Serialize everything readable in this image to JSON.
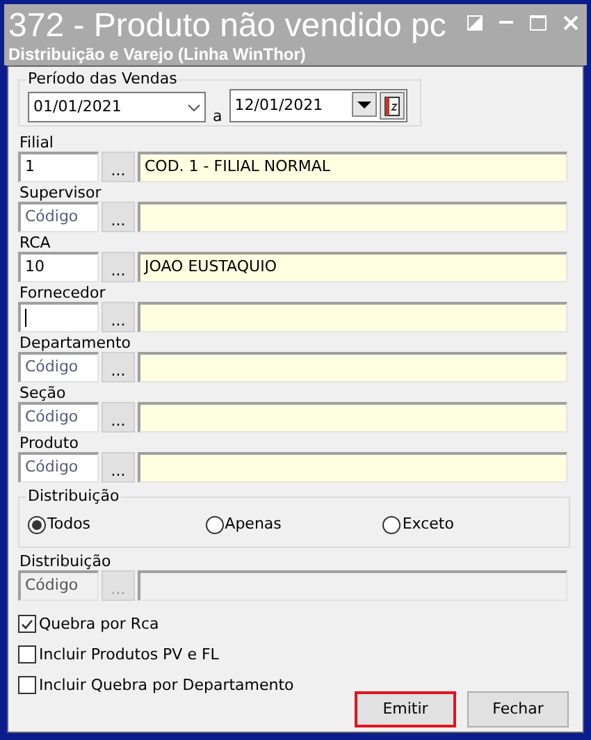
{
  "window": {
    "title": "372 - Produto não vendido pc",
    "subtitle": "Distribuição e Varejo (Linha WinThor)"
  },
  "period": {
    "label": "Período das Vendas",
    "start": "01/01/2021",
    "separator": "a",
    "end": "12/01/2021"
  },
  "fields": [
    {
      "label": "Filial",
      "code": "1",
      "description": "COD. 1 - FILIAL NORMAL",
      "focused": false,
      "disabled": false,
      "button": "..."
    },
    {
      "label": "Supervisor",
      "placeholder": "Código",
      "focused": false,
      "disabled": false,
      "button": "..."
    },
    {
      "label": "RCA",
      "code": "10",
      "description": "JOAO EUSTAQUIO",
      "focused": false,
      "disabled": false,
      "button": "..."
    },
    {
      "label": "Fornecedor",
      "focused": true,
      "disabled": false,
      "button": "..."
    },
    {
      "label": "Departamento",
      "placeholder": "Código",
      "focused": false,
      "disabled": false,
      "button": "..."
    },
    {
      "label": "Seção",
      "placeholder": "Código",
      "focused": false,
      "disabled": false,
      "button": "..."
    },
    {
      "label": "Produto",
      "placeholder": "Código",
      "focused": false,
      "disabled": false,
      "button": "..."
    }
  ],
  "distribution_group": {
    "label": "Distribuição",
    "options": [
      {
        "label": "Todos",
        "selected": true
      },
      {
        "label": "Apenas",
        "selected": false
      },
      {
        "label": "Exceto",
        "selected": false
      }
    ]
  },
  "distribution_field": {
    "label": "Distribuição",
    "placeholder": "Código",
    "focused": false,
    "disabled": true,
    "button": "..."
  },
  "checkboxes": [
    {
      "label": "Quebra por Rca",
      "checked": true
    },
    {
      "label": "Incluir Produtos PV e FL",
      "checked": false
    },
    {
      "label": "Incluir Quebra por Departamento",
      "checked": false
    }
  ],
  "buttons": [
    {
      "label": "Emitir",
      "highlighted": true
    },
    {
      "label": "Fechar",
      "highlighted": false
    }
  ]
}
